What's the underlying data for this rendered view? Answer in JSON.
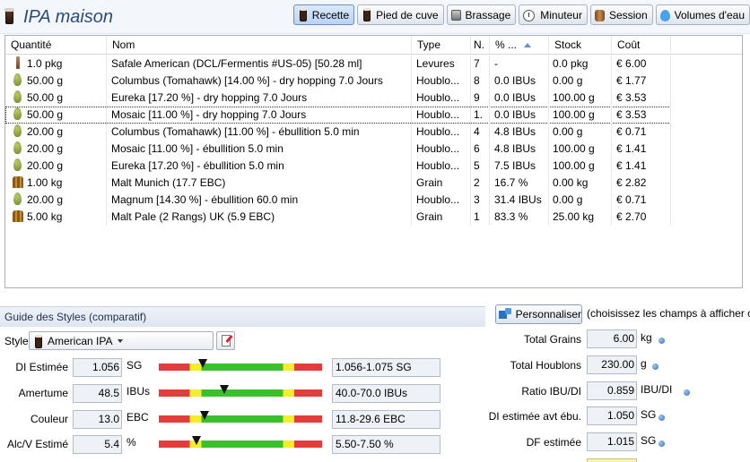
{
  "app": {
    "title": "IPA maison"
  },
  "tabs": [
    {
      "label": "Recette",
      "icon": "beer-glass-icon",
      "active": true
    },
    {
      "label": "Pied de cuve",
      "icon": "beer-glass-icon",
      "active": false
    },
    {
      "label": "Brassage",
      "icon": "mash-tun-icon",
      "active": false
    },
    {
      "label": "Minuteur",
      "icon": "clock-icon",
      "active": false
    },
    {
      "label": "Session",
      "icon": "barrel-icon",
      "active": false
    },
    {
      "label": "Volumes d'eau",
      "icon": "water-drop-icon",
      "active": false
    }
  ],
  "table": {
    "headers": [
      "Quantité",
      "Nom",
      "Type",
      "N.",
      "% ...",
      "Stock",
      "Coût"
    ],
    "rows": [
      {
        "qty": "1.0 pkg",
        "name": "Safale American  (DCL/Fermentis #US-05) [50.28 ml]",
        "type": "Levures",
        "n": "7",
        "pct": "-",
        "stock": "0.0 pkg",
        "cost": "€ 6.00",
        "icon": "yeast-icon"
      },
      {
        "qty": "50.00 g",
        "name": "Columbus (Tomahawk) [14.00 %] - dry hopping 7.0 Jours",
        "type": "Houblo...",
        "n": "8",
        "pct": "0.0 IBUs",
        "stock": "0.00 g",
        "cost": "€ 1.77",
        "icon": "hop-icon"
      },
      {
        "qty": "50.00 g",
        "name": "Eureka [17.20 %] - dry hopping 7.0 Jours",
        "type": "Houblo...",
        "n": "9",
        "pct": "0.0 IBUs",
        "stock": "100.00 g",
        "cost": "€ 3.53",
        "icon": "hop-icon"
      },
      {
        "qty": "50.00 g",
        "name": "Mosaic [11.00 %] - dry hopping 7.0 Jours",
        "type": "Houblo...",
        "n": "1.",
        "pct": "0.0 IBUs",
        "stock": "100.00 g",
        "cost": "€ 3.53",
        "icon": "hop-icon",
        "selected": true
      },
      {
        "qty": "20.00 g",
        "name": "Columbus (Tomahawk) [11.00 %] - ébullition 5.0 min",
        "type": "Houblo...",
        "n": "4",
        "pct": "4.8 IBUs",
        "stock": "0.00 g",
        "cost": "€ 0.71",
        "icon": "hop-icon"
      },
      {
        "qty": "20.00 g",
        "name": "Mosaic [11.00 %] - ébullition 5.0 min",
        "type": "Houblo...",
        "n": "6",
        "pct": "4.8 IBUs",
        "stock": "100.00 g",
        "cost": "€ 1.41",
        "icon": "hop-icon"
      },
      {
        "qty": "20.00 g",
        "name": "Eureka [17.20 %] - ébullition 5.0 min",
        "type": "Houblo...",
        "n": "5",
        "pct": "7.5 IBUs",
        "stock": "100.00 g",
        "cost": "€ 1.41",
        "icon": "hop-icon"
      },
      {
        "qty": "1.00 kg",
        "name": "Malt Munich (17.7 EBC)",
        "type": "Grain",
        "n": "2",
        "pct": "16.7 %",
        "stock": "0.00 kg",
        "cost": "€ 2.82",
        "icon": "grain-icon"
      },
      {
        "qty": "20.00 g",
        "name": "Magnum [14.30 %] - ébullition 60.0 min",
        "type": "Houblo...",
        "n": "3",
        "pct": "31.4 IBUs",
        "stock": "0.00 g",
        "cost": "€ 0.71",
        "icon": "hop-icon"
      },
      {
        "qty": "5.00 kg",
        "name": "Malt Pale (2 Rangs) UK (5.9 EBC)",
        "type": "Grain",
        "n": "1",
        "pct": "83.3 %",
        "stock": "25.00 kg",
        "cost": "€ 2.70",
        "icon": "grain-icon"
      }
    ]
  },
  "style_guide": {
    "title": "Guide des Styles (comparatif)",
    "style_label": "Style",
    "style_value": "American IPA",
    "metrics": [
      {
        "label": "DI Estimée",
        "value": "1.056",
        "unit": "SG",
        "range": "1.056-1.075 SG",
        "level": 0.27
      },
      {
        "label": "Amertume",
        "value": "48.5",
        "unit": "IBUs",
        "range": "40.0-70.0 IBUs",
        "level": 0.4
      },
      {
        "label": "Couleur",
        "value": "13.0",
        "unit": "EBC",
        "range": "11.8-29.6 EBC",
        "level": 0.28
      },
      {
        "label": "Alc/V Estimé",
        "value": "5.4",
        "unit": "%",
        "range": "5.50-7.50 %",
        "level": 0.23
      }
    ]
  },
  "summary": {
    "customize_label": "Personnaliser",
    "hint": "(choisissez les champs à afficher ci",
    "items": [
      {
        "label": "Total Grains",
        "value": "6.00",
        "unit": "kg"
      },
      {
        "label": "Total Houblons",
        "value": "230.00",
        "unit": "g"
      },
      {
        "label": "Ratio IBU/DI",
        "value": "0.859",
        "unit": "IBU/DI"
      },
      {
        "label": "DI estimée avt ébu.",
        "value": "1.050",
        "unit": "SG"
      },
      {
        "label": "DF estimée",
        "value": "1.015",
        "unit": "SG"
      }
    ]
  },
  "colors": {
    "accent": "#2b4a7a",
    "tab_active": "#b9d2f3",
    "bar_red": "#e23d3d",
    "bar_yellow": "#f3ed2c",
    "bar_green": "#3cbf2e"
  }
}
